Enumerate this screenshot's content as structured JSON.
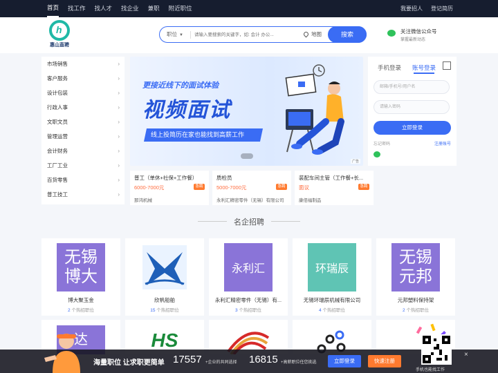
{
  "topnav": {
    "items": [
      "首页",
      "找工作",
      "找人才",
      "找企业",
      "兼职",
      "附近职位"
    ],
    "right": [
      "我要招人",
      "登记简历"
    ]
  },
  "logo": {
    "text": "惠山直聘"
  },
  "search": {
    "category": "职位",
    "placeholder": "请输入要搜索的关键字，如: 会计 办公...",
    "map_label": "地图",
    "button": "搜索"
  },
  "wechat": {
    "title": "关注微信公众号",
    "sub": "掌握最新动态"
  },
  "categories": [
    "市场销售",
    "客户服务",
    "设计包装",
    "行政人事",
    "文职文员",
    "管理运营",
    "会计财务",
    "工厂工业",
    "百货零售",
    "普工技工"
  ],
  "banner": {
    "line1": "更接近线下的面试体验",
    "line2": "视频面试",
    "line3": "线上投简历在家也能找到高薪工作",
    "ad": "广告"
  },
  "login": {
    "tab_phone": "手机登录",
    "tab_account": "账号登录",
    "username_placeholder": "邮箱/手机号/用户名",
    "password_placeholder": "请输入密码",
    "button": "立即登录",
    "forgot": "忘记密码",
    "register": "注册账号"
  },
  "jobs": [
    {
      "title": "普工（单休+社保+工作餐）",
      "salary": "6000-7000元",
      "tag": "急聘",
      "company": "那鸿机械"
    },
    {
      "title": "质检员",
      "salary": "5000-7000元",
      "tag": "急聘",
      "company": "永利汇精密零件（无锡）有限公司"
    },
    {
      "title": "装配车间主管（工作餐+长...",
      "salary": "面议",
      "tag": "急聘",
      "company": "康佰福制品"
    }
  ],
  "section_title": "名企招聘",
  "companies": [
    {
      "logo": "无锡博大",
      "name": "博大聚玉金",
      "count": "2",
      "count_suffix": "个热招职位"
    },
    {
      "logo": "",
      "name": "欣帆船舶",
      "count": "15",
      "count_suffix": "个热招职位"
    },
    {
      "logo": "永利汇",
      "name": "永利汇精密零件（无锡）有...",
      "count": "3",
      "count_suffix": "个热招职位"
    },
    {
      "logo": "环瑞辰",
      "name": "无锡环瑞辰机械有限公司",
      "count": "4",
      "count_suffix": "个热招职位"
    },
    {
      "logo": "无锡元邦",
      "name": "元邦塑料保持架",
      "count": "2",
      "count_suffix": "个热招职位"
    }
  ],
  "second_row_logos": [
    "达",
    "HS",
    "",
    "",
    ""
  ],
  "float_bar": {
    "slogan": "海量职位 让求职更简单",
    "num1": "17557",
    "num1_label": "+企业的共同选择",
    "num2": "16815",
    "num2_label": "+高薪职位任您挑选",
    "login": "立即登录",
    "register": "快速注册",
    "qr_text": "手机也能找工作",
    "close": "×"
  },
  "colors": {
    "brand": "#3a6cf4",
    "accent": "#ff7a2f",
    "logo_teal": "#1fb9a6",
    "company_purple": "#8a74d8",
    "company_teal": "#5fc4b4"
  }
}
